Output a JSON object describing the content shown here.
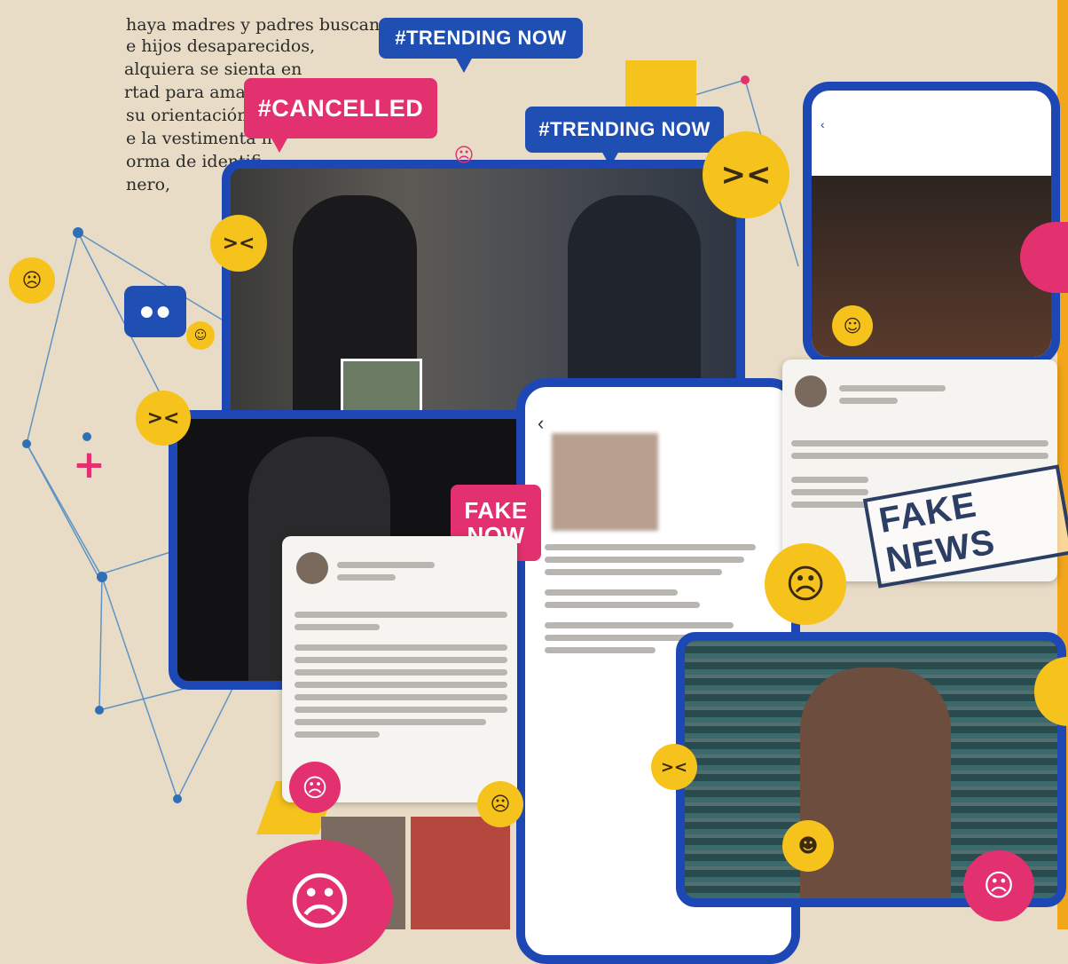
{
  "prose_lines": [
    "haya madres y padres buscando a",
    "e hijos desaparecidos,",
    "alquiera se sienta en",
    "rtad para amar sin",
    "su orientación se-",
    "e la vestimenta no",
    "orma de identifi-",
    "nero,"
  ],
  "bubbles": {
    "trending_top": "#TRENDING NOW",
    "trending_mid": "#TRENDING NOW",
    "cancelled": "#CANCELLED",
    "fake_now_1": "FAKE",
    "fake_now_2": "NOW"
  },
  "stamp": "FAKE NEWS",
  "icons": {
    "laugh": "laughing-emoji",
    "sad": "sad-emoji",
    "angry": "angry-emoji",
    "chat": "chat-bubble-icon",
    "plus": "plus-icon",
    "back": "back-arrow-icon"
  },
  "colors": {
    "background": "#e9dcc6",
    "frame_blue": "#1d47b5",
    "pink": "#e3306f",
    "yellow": "#f6c21c",
    "orange": "#f2a61b"
  }
}
